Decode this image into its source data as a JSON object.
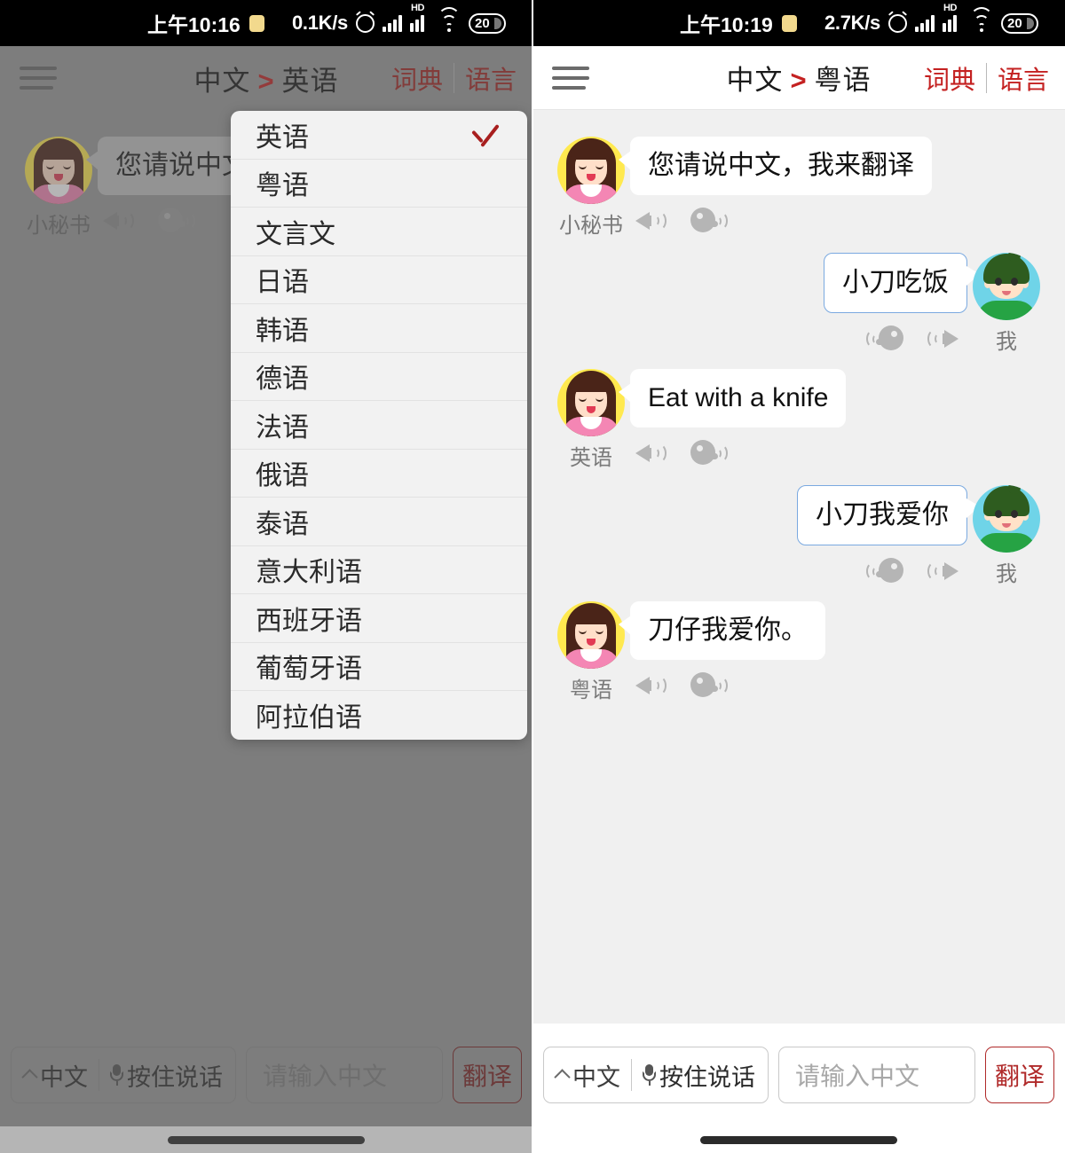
{
  "panels": [
    {
      "id": "left",
      "status": {
        "time": "上午10:16",
        "net_speed": "0.1K/s",
        "battery": "20",
        "icons": [
          "note-chip-icon",
          "alarm-icon",
          "signal-bars-icon",
          "hd-signal-icon",
          "wifi-icon",
          "battery-icon"
        ]
      },
      "header": {
        "menu_icon": "hamburger-menu-icon",
        "source_lang": "中文",
        "arrow": "＞",
        "target_lang": "英语",
        "dictionary_label": "词典",
        "language_label": "语言",
        "accent_color": "#c42121"
      },
      "messages": [
        {
          "side": "left",
          "speaker": "小秘书",
          "text": "您请说中文，",
          "avatar": "assistant-avatar",
          "icons": [
            "speaker-icon",
            "speaking-head-icon"
          ]
        }
      ],
      "dropdown": {
        "open": true,
        "selected": "英语",
        "check_icon": "check-icon",
        "check_color": "#a81f1f",
        "items": [
          "英语",
          "粤语",
          "文言文",
          "日语",
          "韩语",
          "德语",
          "法语",
          "俄语",
          "泰语",
          "意大利语",
          "西班牙语",
          "葡萄牙语",
          "阿拉伯语"
        ]
      },
      "bottom": {
        "lang_button": "中文",
        "chevron_icon": "chevron-up-icon",
        "mic_icon": "microphone-icon",
        "hold_to_talk": "按住说话",
        "input_placeholder": "请输入中文",
        "input_value": "",
        "translate_button": "翻译",
        "translate_color": "#b02a2a"
      }
    },
    {
      "id": "right",
      "status": {
        "time": "上午10:19",
        "net_speed": "2.7K/s",
        "battery": "20",
        "icons": [
          "note-chip-icon",
          "alarm-icon",
          "signal-bars-icon",
          "hd-signal-icon",
          "wifi-icon",
          "battery-icon"
        ]
      },
      "header": {
        "menu_icon": "hamburger-menu-icon",
        "source_lang": "中文",
        "arrow": "＞",
        "target_lang": "粤语",
        "dictionary_label": "词典",
        "language_label": "语言",
        "accent_color": "#c42121"
      },
      "messages": [
        {
          "side": "left",
          "speaker": "小秘书",
          "text": "您请说中文，我来翻译",
          "avatar": "assistant-avatar",
          "icons": [
            "speaker-icon",
            "speaking-head-icon"
          ]
        },
        {
          "side": "right",
          "speaker": "我",
          "text": "小刀吃饭",
          "avatar": "user-avatar",
          "icons": [
            "speaking-head-icon",
            "speaker-icon"
          ]
        },
        {
          "side": "left",
          "speaker": "英语",
          "text": "Eat with a knife",
          "avatar": "assistant-avatar",
          "icons": [
            "speaker-icon",
            "speaking-head-icon"
          ]
        },
        {
          "side": "right",
          "speaker": "我",
          "text": "小刀我爱你",
          "avatar": "user-avatar",
          "icons": [
            "speaking-head-icon",
            "speaker-icon"
          ]
        },
        {
          "side": "left",
          "speaker": "粤语",
          "text": "刀仔我爱你。",
          "avatar": "assistant-avatar",
          "icons": [
            "speaker-icon",
            "speaking-head-icon"
          ]
        }
      ],
      "dropdown": {
        "open": false
      },
      "bottom": {
        "lang_button": "中文",
        "chevron_icon": "chevron-up-icon",
        "mic_icon": "microphone-icon",
        "hold_to_talk": "按住说话",
        "input_placeholder": "请输入中文",
        "input_value": "",
        "translate_button": "翻译",
        "translate_color": "#b02a2a"
      }
    }
  ]
}
